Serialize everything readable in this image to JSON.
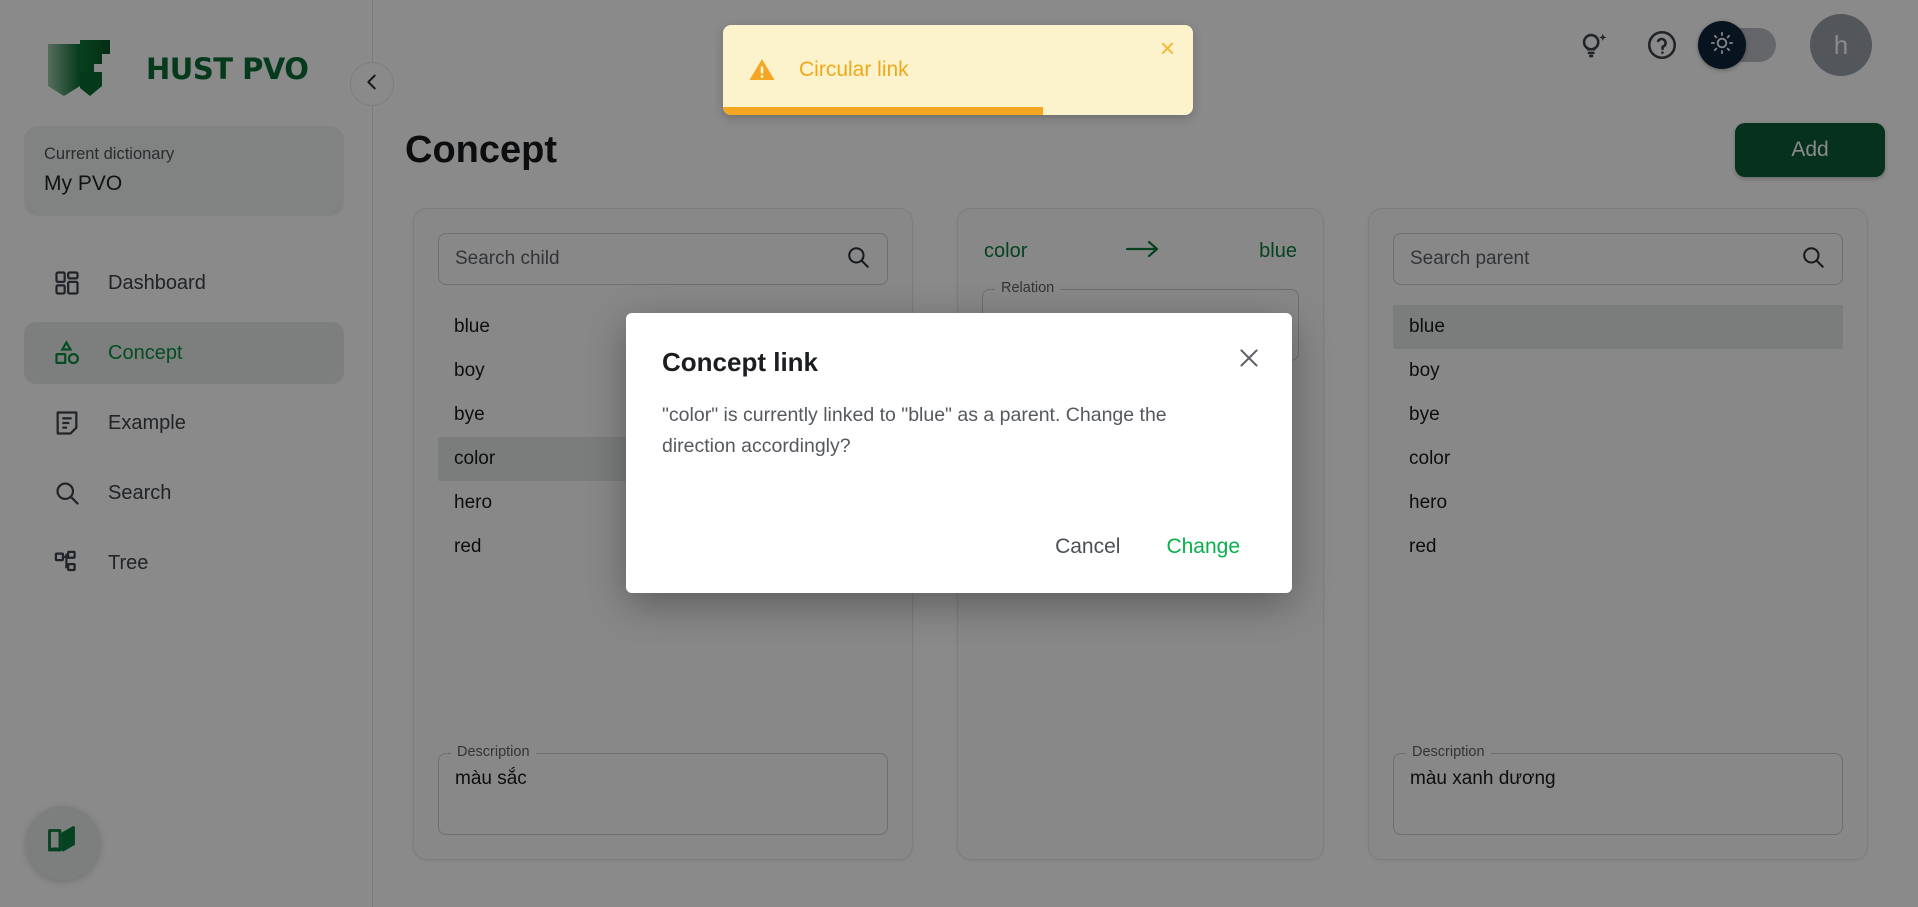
{
  "brand": {
    "name": "HUST PVO",
    "logo_icon": "open-book-logo",
    "accent_green": "#0a6b35",
    "button_green": "#0a5c36"
  },
  "sidebar": {
    "collapse_icon": "chevron-left-icon",
    "dictionary": {
      "label": "Current dictionary",
      "value": "My PVO"
    },
    "items": [
      {
        "label": "Dashboard",
        "icon": "dashboard-icon",
        "active": false
      },
      {
        "label": "Concept",
        "icon": "shapes-icon",
        "active": true
      },
      {
        "label": "Example",
        "icon": "note-icon",
        "active": false
      },
      {
        "label": "Search",
        "icon": "search-icon",
        "active": false
      },
      {
        "label": "Tree",
        "icon": "tree-icon",
        "active": false
      }
    ],
    "fab_icon": "open-book-icon"
  },
  "header": {
    "icons": [
      {
        "name": "lightbulb-sparkle-icon"
      },
      {
        "name": "help-circle-icon"
      }
    ],
    "theme_toggle": {
      "icon": "sun-icon",
      "state": "light",
      "track_color": "#b9bdc2",
      "knob_color": "#10243b"
    },
    "avatar": {
      "initial": "h"
    }
  },
  "main": {
    "title": "Concept",
    "add_label": "Add"
  },
  "child_panel": {
    "search": {
      "placeholder": "Search child",
      "value": "",
      "icon": "search-icon"
    },
    "items": [
      "blue",
      "boy",
      "bye",
      "color",
      "hero",
      "red"
    ],
    "selected": "color",
    "description": {
      "legend": "Description",
      "value": "màu sắc"
    }
  },
  "relation_panel": {
    "source": "color",
    "arrow_icon": "arrow-right-icon",
    "target": "blue",
    "relation_field": {
      "legend": "Relation",
      "value": ""
    },
    "link_label": ""
  },
  "parent_panel": {
    "search": {
      "placeholder": "Search parent",
      "value": "",
      "icon": "search-icon"
    },
    "items": [
      "blue",
      "boy",
      "bye",
      "color",
      "hero",
      "red"
    ],
    "selected": "blue",
    "description": {
      "legend": "Description",
      "value": "màu xanh dương"
    }
  },
  "toast": {
    "icon": "warning-triangle-icon",
    "message": "Circular link",
    "close_label": "×",
    "background": "#fcf3cd",
    "accent": "#f5a623",
    "progress_percent": 68
  },
  "modal": {
    "title": "Concept link",
    "close_icon": "close-icon",
    "body": "\"color\" is currently linked to \"blue\" as a parent. Change the direction accordingly?",
    "cancel_label": "Cancel",
    "confirm_label": "Change",
    "confirm_color": "#06b14a"
  }
}
